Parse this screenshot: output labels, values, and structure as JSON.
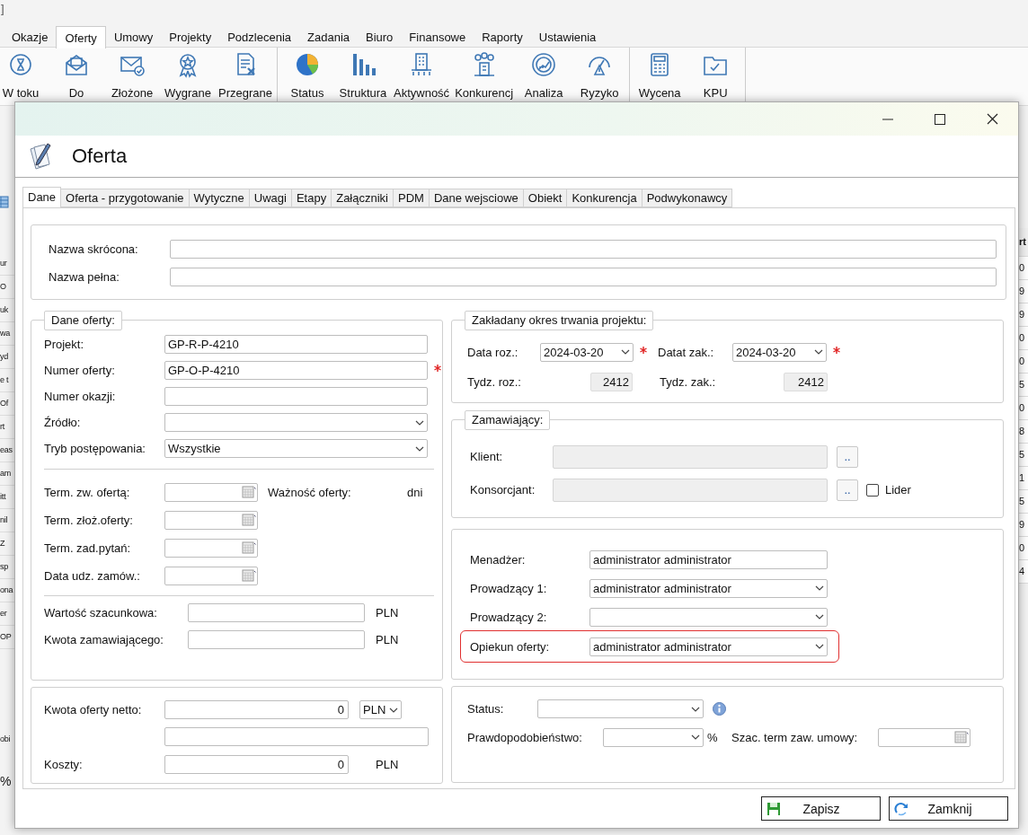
{
  "app": {
    "corner_text": "]",
    "ribbon_tabs": [
      {
        "label": "Okazje",
        "selected": false
      },
      {
        "label": "Oferty",
        "selected": true
      },
      {
        "label": "Umowy",
        "selected": false
      },
      {
        "label": "Projekty",
        "selected": false
      },
      {
        "label": "Podzlecenia",
        "selected": false
      },
      {
        "label": "Zadania",
        "selected": false
      },
      {
        "label": "Biuro",
        "selected": false
      },
      {
        "label": "Finansowe",
        "selected": false
      },
      {
        "label": "Raporty",
        "selected": false
      },
      {
        "label": "Ustawienia",
        "selected": false
      }
    ],
    "toolbar_groups": [
      [
        {
          "label": "W toku"
        },
        {
          "label": "Do"
        },
        {
          "label": "Złożone"
        },
        {
          "label": "Wygrane"
        },
        {
          "label": "Przegrane"
        }
      ],
      [
        {
          "label": "Status"
        },
        {
          "label": "Struktura"
        },
        {
          "label": "Aktywność"
        },
        {
          "label": "Konkurencj"
        },
        {
          "label": "Analiza"
        },
        {
          "label": "Ryzyko"
        }
      ],
      [
        {
          "label": "Wycena"
        },
        {
          "label": "KPU"
        }
      ]
    ],
    "left_fragments": [
      "ur",
      "O",
      "uk",
      "wa",
      "yd",
      "e t",
      "Of",
      "rt",
      "eas",
      "am",
      "itt",
      "nil",
      "Z",
      "sp",
      "ona",
      "er",
      "OP"
    ],
    "bottom_fragments": [
      "obi",
      "%"
    ],
    "right_header": "rt",
    "right_fragments": [
      "0",
      "9",
      "9",
      "0",
      "0",
      "5",
      "0",
      "8",
      "5",
      "1",
      "5",
      "9",
      "0",
      "4"
    ]
  },
  "dialog": {
    "heading": "Oferta",
    "tabs": [
      {
        "label": "Dane",
        "selected": true
      },
      {
        "label": "Oferta - przygotowanie",
        "selected": false
      },
      {
        "label": "Wytyczne",
        "selected": false
      },
      {
        "label": "Uwagi",
        "selected": false
      },
      {
        "label": "Etapy",
        "selected": false
      },
      {
        "label": "Załączniki",
        "selected": false
      },
      {
        "label": "PDM",
        "selected": false
      },
      {
        "label": "Dane wejsciowe",
        "selected": false
      },
      {
        "label": "Obiekt",
        "selected": false
      },
      {
        "label": "Konkurencja",
        "selected": false
      },
      {
        "label": "Podwykonawcy",
        "selected": false
      }
    ],
    "names": [
      {
        "label": "Nazwa skrócona:"
      },
      {
        "label": "Nazwa pełna:"
      }
    ],
    "dane_oferty": {
      "legend": "Dane oferty:",
      "fields": [
        {
          "kind": "text",
          "label": "Projekt:",
          "value": "GP-R-P-4210",
          "required": false
        },
        {
          "kind": "text",
          "label": "Numer oferty:",
          "value": "GP-O-P-4210",
          "required": true
        },
        {
          "kind": "text",
          "label": "Numer okazji:",
          "required": false
        },
        {
          "kind": "select",
          "label": "Źródło:",
          "required": false
        },
        {
          "kind": "select",
          "label": "Tryb postępowania:",
          "value": "Wszystkie",
          "required": false
        }
      ],
      "dates": [
        {
          "label": "Term. zw. ofertą:"
        },
        {
          "label": "Term. złoż.oferty:"
        },
        {
          "label": "Term. zad.pytań:"
        },
        {
          "label": "Data udz. zamów.:"
        }
      ],
      "validity": {
        "label": "Ważność oferty:",
        "unit": "dni"
      },
      "amounts": [
        {
          "label": "Wartość szacunkowa:",
          "currency": "PLN"
        },
        {
          "label": "Kwota zamawiającego:",
          "currency": "PLN"
        }
      ]
    },
    "netto": {
      "label": "Kwota oferty netto:",
      "value": "0",
      "currency": "PLN"
    },
    "costs": {
      "label": "Koszty:",
      "value": "0",
      "currency": "PLN"
    },
    "period": {
      "legend": "Zakładany okres trwania projektu:",
      "start": {
        "label": "Data roz.:",
        "value": "2024-03-20",
        "required": true
      },
      "end": {
        "label": "Datat zak.:",
        "value": "2024-03-20",
        "required": true
      },
      "week_start": {
        "label": "Tydz. roz.:",
        "value": "2412"
      },
      "week_end": {
        "label": "Tydz. zak.:",
        "value": "2412"
      }
    },
    "ordering": {
      "legend": "Zamawiający:",
      "rows": [
        {
          "label": "Klient:",
          "button": ".."
        },
        {
          "label": "Konsorcjant:",
          "button": ".."
        }
      ],
      "leader": {
        "label": "Lider",
        "checked": false
      }
    },
    "people": [
      {
        "kind": "text",
        "label": "Menadżer:",
        "value": "administrator administrator",
        "highlighted": false
      },
      {
        "kind": "select",
        "label": "Prowadzący 1:",
        "value": "administrator administrator",
        "highlighted": false
      },
      {
        "kind": "select",
        "label": "Prowadzący 2:",
        "highlighted": false
      },
      {
        "kind": "select",
        "label": "Opiekun oferty:",
        "value": "administrator administrator",
        "highlighted": true
      }
    ],
    "status": {
      "label": "Status:"
    },
    "probability": {
      "label": "Prawdopodobieństwo:",
      "unit": "%"
    },
    "contract_date": {
      "label": "Szac. term zaw. umowy:"
    },
    "buttons": [
      {
        "kind": "save",
        "label": "Zapisz"
      },
      {
        "kind": "close",
        "label": "Zamknij"
      }
    ]
  }
}
